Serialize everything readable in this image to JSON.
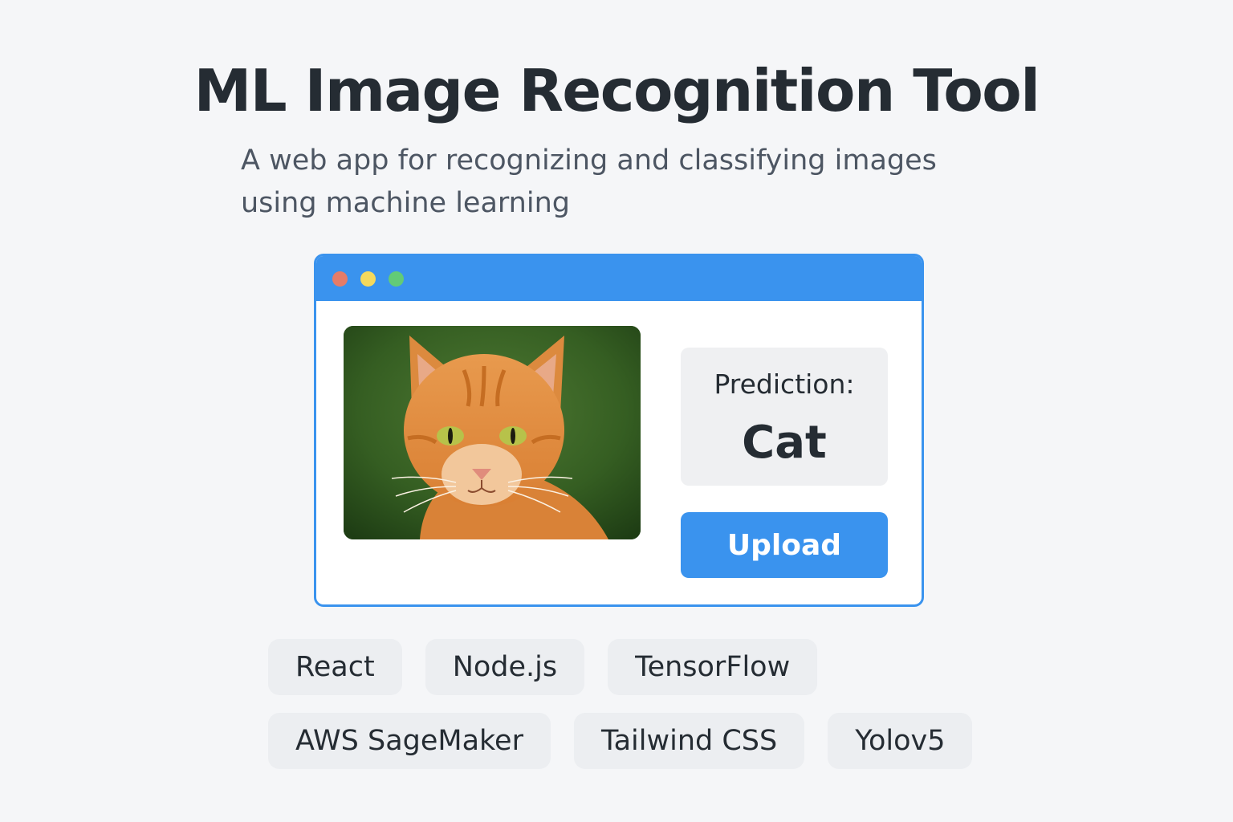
{
  "header": {
    "title": "ML Image Recognition Tool",
    "subtitle": "A web app for recognizing and classifying images using machine learning"
  },
  "window": {
    "accent_color": "#3a93ee",
    "controls": [
      "close-dot",
      "minimize-dot",
      "maximize-dot"
    ],
    "image": {
      "subject": "orange tabby cat"
    },
    "prediction": {
      "label": "Prediction:",
      "value": "Cat"
    },
    "upload_label": "Upload"
  },
  "tags": {
    "row1": [
      "React",
      "Node.js",
      "TensorFlow"
    ],
    "row2": [
      "AWS SageMaker",
      "Tailwind CSS",
      "Yolov5"
    ]
  }
}
